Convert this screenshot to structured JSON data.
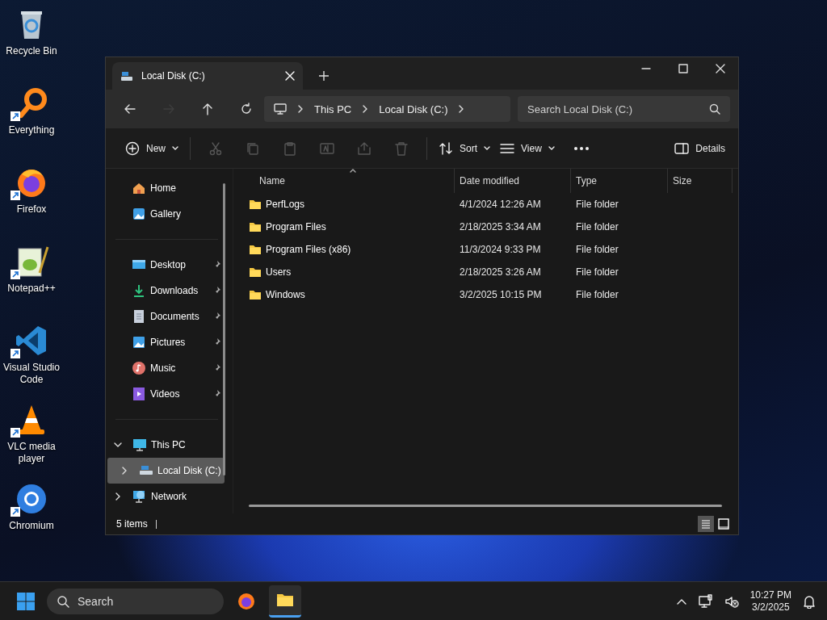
{
  "desktop_icons": [
    {
      "label": "Recycle Bin",
      "shortcut": false
    },
    {
      "label": "Everything",
      "shortcut": true
    },
    {
      "label": "Firefox",
      "shortcut": true
    },
    {
      "label": "Notepad++",
      "shortcut": true
    },
    {
      "label": "Visual Studio Code",
      "shortcut": true
    },
    {
      "label": "VLC media player",
      "shortcut": true
    },
    {
      "label": "Chromium",
      "shortcut": true
    }
  ],
  "window": {
    "tab": {
      "title": "Local Disk (C:)",
      "selected": true
    },
    "breadcrumb": [
      "This PC",
      "Local Disk (C:)"
    ],
    "search": {
      "placeholder": "Search Local Disk (C:)"
    },
    "nav_buttons": [
      {
        "disabled": false
      },
      {
        "disabled": true
      },
      {
        "disabled": false
      },
      {
        "disabled": false
      }
    ],
    "toolbar": {
      "new": {
        "label": "New"
      },
      "actions": [
        {
          "disabled": true
        },
        {
          "disabled": true
        },
        {
          "disabled": true
        },
        {
          "disabled": true
        },
        {
          "disabled": true
        },
        {
          "disabled": true
        }
      ],
      "sort": {
        "label": "Sort"
      },
      "view": {
        "label": "View"
      },
      "details": {
        "label": "Details"
      }
    },
    "sidebar": {
      "top": [
        {
          "label": "Home",
          "selected": false
        },
        {
          "label": "Gallery",
          "selected": false
        }
      ],
      "quick_access": [
        {
          "label": "Desktop",
          "pinned": true
        },
        {
          "label": "Downloads",
          "pinned": true
        },
        {
          "label": "Documents",
          "pinned": true
        },
        {
          "label": "Pictures",
          "pinned": true
        },
        {
          "label": "Music",
          "pinned": true
        },
        {
          "label": "Videos",
          "pinned": true
        }
      ],
      "tree": [
        {
          "label": "This PC",
          "expanded": true,
          "selected": false,
          "children": [
            {
              "label": "Local Disk (C:)",
              "expanded": false,
              "selected": true
            }
          ]
        },
        {
          "label": "Network",
          "expanded": false,
          "selected": false
        }
      ]
    },
    "table": {
      "columns": [
        "Name",
        "Date modified",
        "Type",
        "Size"
      ],
      "rows": [
        {
          "name": "PerfLogs",
          "date": "4/1/2024 12:26 AM",
          "type": "File folder"
        },
        {
          "name": "Program Files",
          "date": "2/18/2025 3:34 AM",
          "type": "File folder"
        },
        {
          "name": "Program Files (x86)",
          "date": "11/3/2024 9:33 PM",
          "type": "File folder"
        },
        {
          "name": "Users",
          "date": "2/18/2025 3:26 AM",
          "type": "File folder"
        },
        {
          "name": "Windows",
          "date": "3/2/2025 10:15 PM",
          "type": "File folder"
        }
      ]
    },
    "status_bar": {
      "text": "5 items",
      "views": [
        {
          "selected": true
        },
        {
          "selected": false
        }
      ]
    }
  },
  "taskbar": {
    "search": {
      "placeholder": "Search"
    },
    "apps": [
      {
        "active": false
      },
      {
        "active": true
      }
    ],
    "time": "10:27 PM",
    "date": "3/2/2025"
  }
}
